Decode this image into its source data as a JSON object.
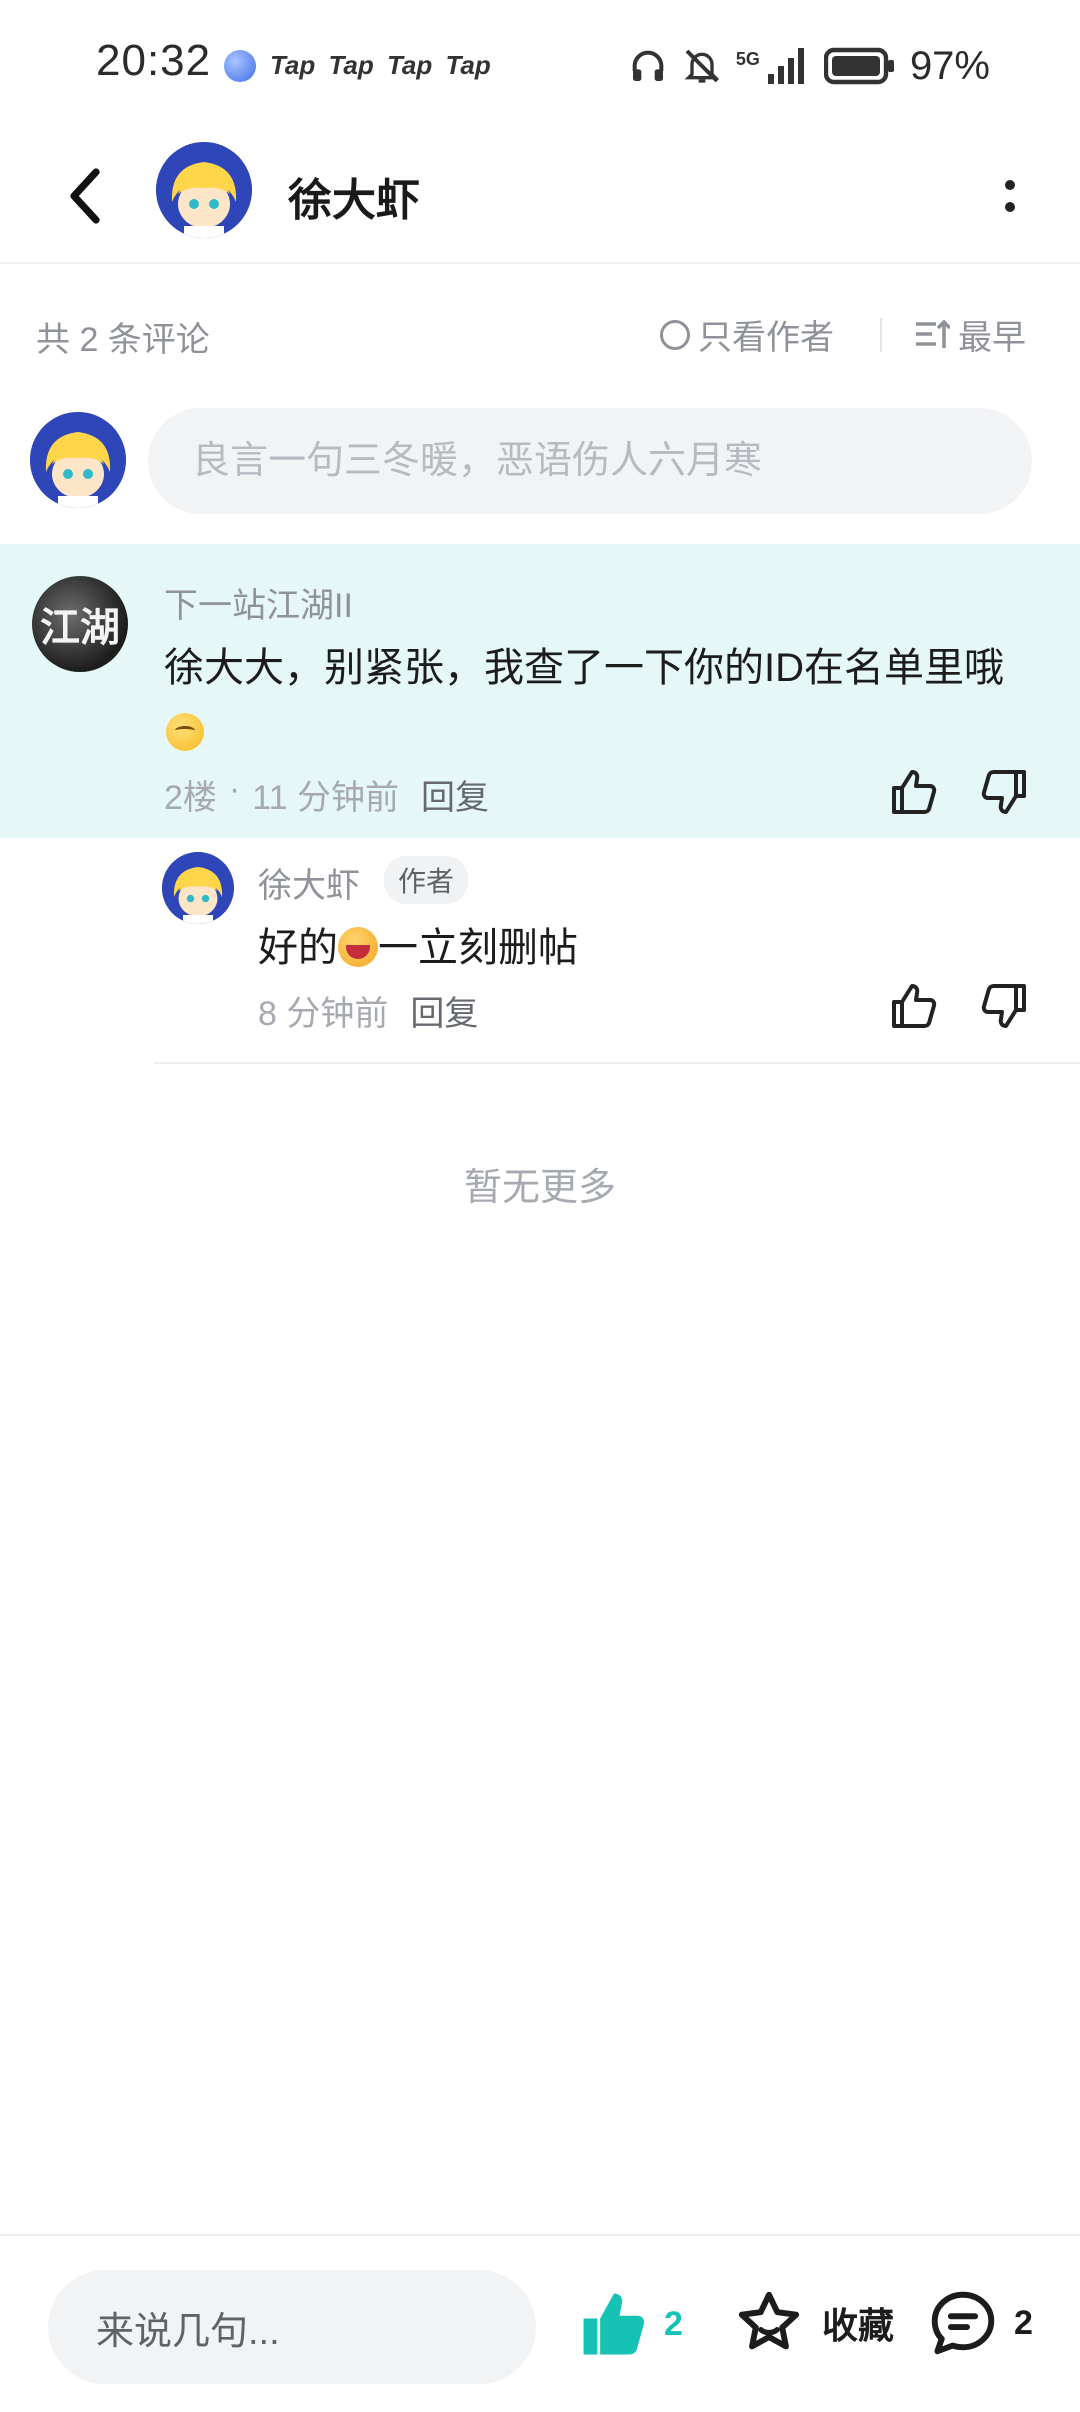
{
  "status_bar": {
    "time": "20:32",
    "app_badges": "Tap Tap Tap Tap",
    "network": "5G",
    "battery": "97%"
  },
  "header": {
    "title": "徐大虾"
  },
  "filter": {
    "count": "共 2 条评论",
    "author_only": "只看作者",
    "sort": "最早"
  },
  "comment_box": {
    "placeholder": "良言一句三冬暖，恶语伤人六月寒"
  },
  "floor_comment": {
    "avatar_text": "江湖",
    "username": "下一站江湖II",
    "text": "徐大大，别紧张，我查了一下你的ID在名单里哦",
    "floor": "2楼",
    "time": "11 分钟前",
    "reply": "回复"
  },
  "sub_reply": {
    "username": "徐大虾",
    "badge": "作者",
    "text_before": "好的",
    "text_after": "一立刻删帖",
    "time": "8 分钟前",
    "reply": "回复"
  },
  "no_more": "暂无更多",
  "bottom_bar": {
    "input_placeholder": "来说几句...",
    "like_count": "2",
    "favorite_label": "收藏",
    "comment_count": "2"
  },
  "colors": {
    "accent": "#16c2b3",
    "highlight_bg": "#e6f7f7",
    "muted_text": "#8f9399"
  }
}
